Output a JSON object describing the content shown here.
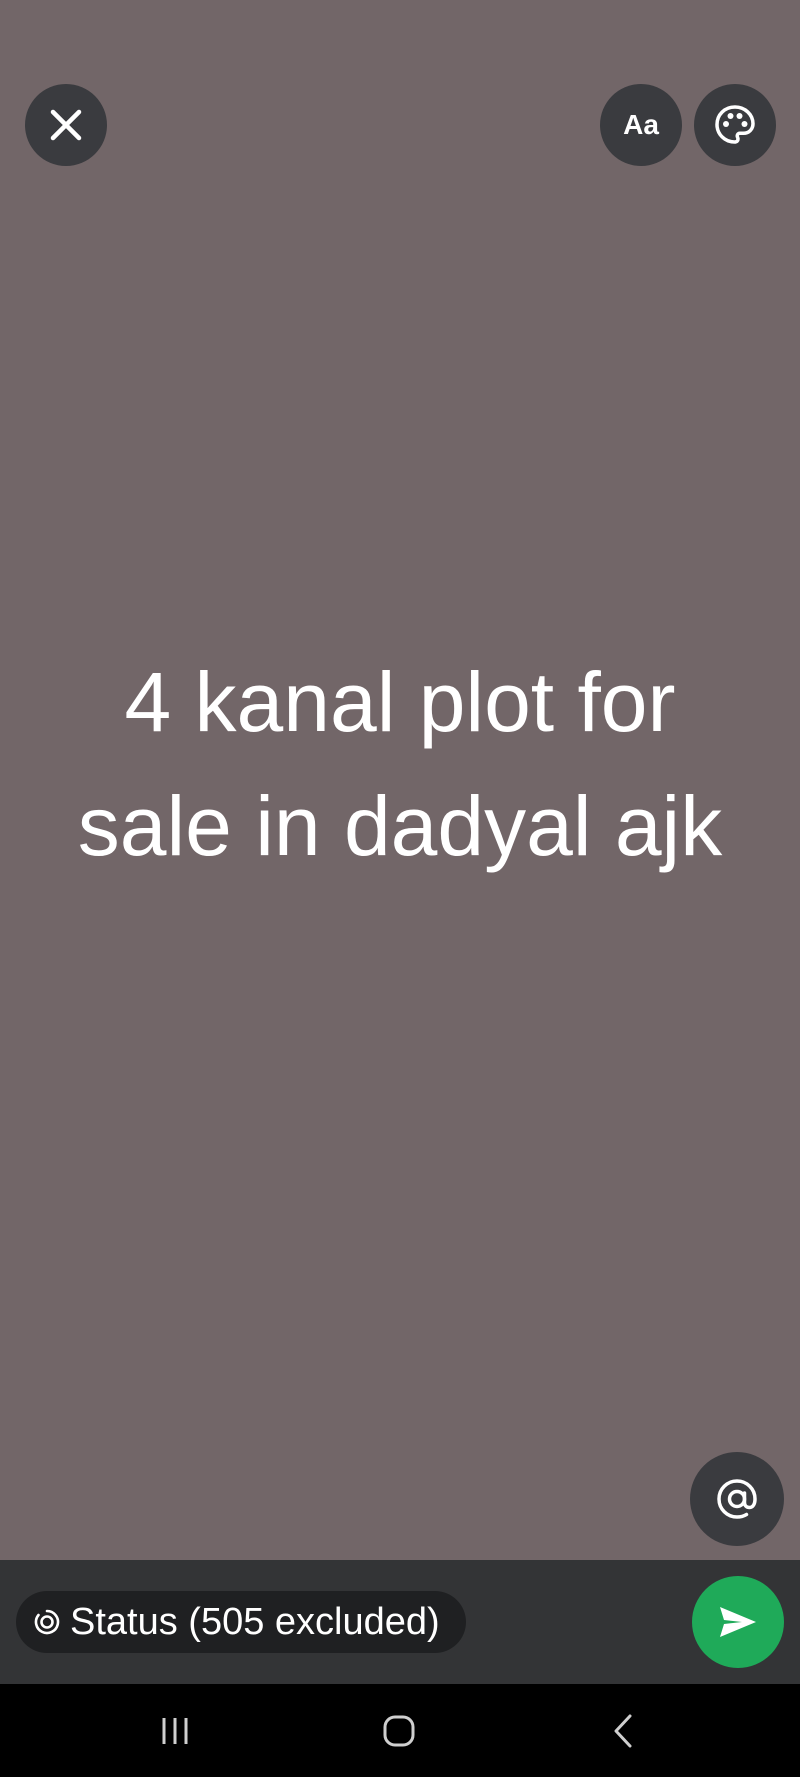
{
  "status_text": "4 kanal plot for sale in dadyal ajk",
  "toolbar": {
    "close_icon": "close-icon",
    "font_label": "Aa",
    "palette_icon": "palette-icon"
  },
  "mention_icon": "at-sign-icon",
  "audience": {
    "icon": "status-ring-icon",
    "label": "Status (505 excluded)"
  },
  "send_icon": "send-icon",
  "nav": {
    "recents_icon": "recents-icon",
    "home_icon": "home-icon",
    "back_icon": "back-icon"
  },
  "colors": {
    "background": "#726668",
    "button_bg": "#3a3b3f",
    "bottom_bar": "#333436",
    "pill_bg": "#1f2022",
    "send": "#1faa59"
  }
}
